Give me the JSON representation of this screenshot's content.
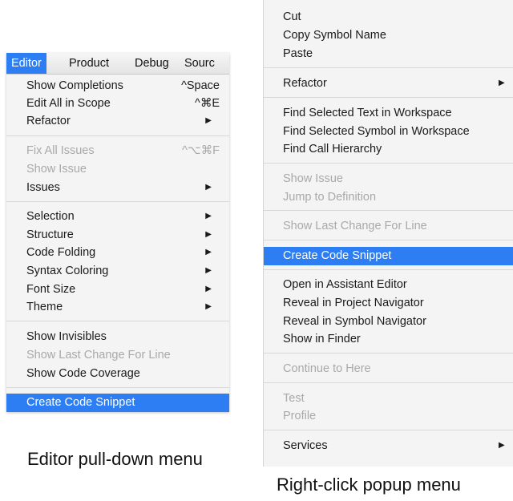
{
  "editor_menu": {
    "menubar": [
      "Editor",
      "Product",
      "Debug",
      "Sourc"
    ],
    "items": [
      {
        "label": "Show Completions",
        "shortcut": "^Space"
      },
      {
        "label": "Edit All in Scope",
        "shortcut": "^⌘E"
      },
      {
        "label": "Refactor",
        "submenu": true
      },
      {
        "label": "Fix All Issues",
        "shortcut": "^⌥⌘F",
        "disabled": true
      },
      {
        "label": "Show Issue",
        "disabled": true
      },
      {
        "label": "Issues",
        "submenu": true
      },
      {
        "label": "Selection",
        "submenu": true
      },
      {
        "label": "Structure",
        "submenu": true
      },
      {
        "label": "Code Folding",
        "submenu": true
      },
      {
        "label": "Syntax Coloring",
        "submenu": true
      },
      {
        "label": "Font Size",
        "submenu": true
      },
      {
        "label": "Theme",
        "submenu": true
      },
      {
        "label": "Show Invisibles"
      },
      {
        "label": "Show Last Change For Line",
        "disabled": true
      },
      {
        "label": "Show Code Coverage"
      },
      {
        "label": "Create Code Snippet",
        "highlighted": true
      }
    ]
  },
  "popup_menu": {
    "items": [
      {
        "label": "Cut"
      },
      {
        "label": "Copy Symbol Name"
      },
      {
        "label": "Paste"
      },
      {
        "label": "Refactor",
        "submenu": true
      },
      {
        "label": "Find Selected Text in Workspace"
      },
      {
        "label": "Find Selected Symbol in Workspace"
      },
      {
        "label": "Find Call Hierarchy"
      },
      {
        "label": "Show Issue",
        "disabled": true
      },
      {
        "label": "Jump to Definition",
        "disabled": true
      },
      {
        "label": "Show Last Change For Line",
        "disabled": true
      },
      {
        "label": "Create Code Snippet",
        "highlighted": true
      },
      {
        "label": "Open in Assistant Editor"
      },
      {
        "label": "Reveal in Project Navigator"
      },
      {
        "label": "Reveal in Symbol Navigator"
      },
      {
        "label": "Show in Finder"
      },
      {
        "label": "Continue to Here",
        "disabled": true
      },
      {
        "label": "Test",
        "disabled": true
      },
      {
        "label": "Profile",
        "disabled": true
      },
      {
        "label": "Services",
        "submenu": true
      }
    ]
  },
  "captions": {
    "left": "Editor pull-down menu",
    "right": "Right-click popup menu"
  },
  "icons": {
    "submenu_arrow": "▶"
  },
  "colors": {
    "highlight": "#2d7ef3",
    "menu_bg": "#f4f4f4",
    "disabled_text": "#a9a9a9"
  }
}
